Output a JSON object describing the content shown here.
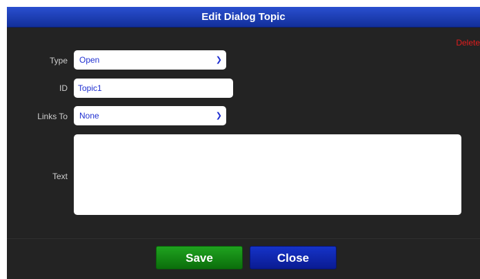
{
  "dialog": {
    "title": "Edit Dialog Topic",
    "delete_label": "Delete"
  },
  "form": {
    "type": {
      "label": "Type",
      "value": "Open"
    },
    "id": {
      "label": "ID",
      "value": "Topic1"
    },
    "links_to": {
      "label": "Links To",
      "value": "None"
    },
    "text": {
      "label": "Text",
      "value": ""
    }
  },
  "buttons": {
    "save_label": "Save",
    "close_label": "Close"
  }
}
